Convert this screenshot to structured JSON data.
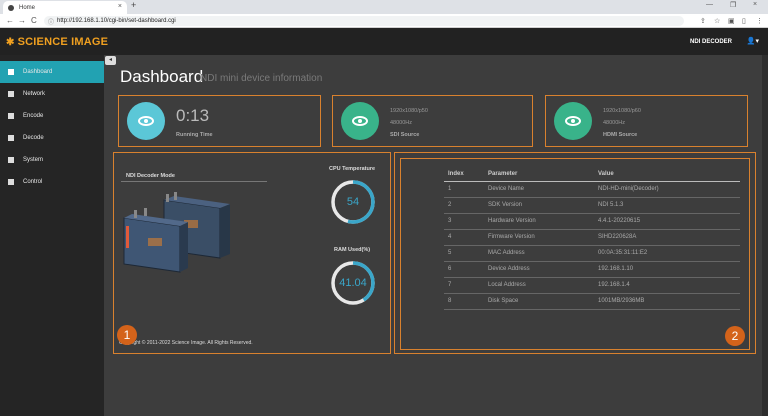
{
  "browser": {
    "tab_title": "Home",
    "tab_close": "×",
    "new_tab": "+",
    "url": "http://192.168.1.10/cgi-bin/set-dashboard.cgi",
    "win_min": "—",
    "win_max": "❐",
    "win_close": "×",
    "back": "←",
    "forward": "→",
    "reload": "C"
  },
  "header": {
    "brand": "SCIENCE IMAGE",
    "device_label": "NDI DECODER",
    "user_icon": "user-icon"
  },
  "sidebar": {
    "items": [
      {
        "label": "Dashboard",
        "icon": "home-icon",
        "active": true
      },
      {
        "label": "Network",
        "icon": "network-icon",
        "active": false
      },
      {
        "label": "Encode",
        "icon": "encode-icon",
        "active": false
      },
      {
        "label": "Decode",
        "icon": "monitor-icon",
        "active": false
      },
      {
        "label": "System",
        "icon": "system-icon",
        "active": false
      },
      {
        "label": "Control",
        "icon": "control-icon",
        "active": false
      }
    ]
  },
  "page": {
    "title": "Dashboard",
    "subtitle": "NDI mini device information"
  },
  "cards": {
    "running": {
      "value": "0:13",
      "label": "Running Time",
      "color": "#5bc7d7"
    },
    "sdi": {
      "line1": "1920x1080/p50",
      "line2": "48000Hz",
      "label": "SDI Source",
      "color": "#39b38a"
    },
    "hdmi": {
      "line1": "1920x1080/p60",
      "line2": "48000Hz",
      "label": "HDMI Source",
      "color": "#39b38a"
    }
  },
  "left_panel": {
    "mode_title": "NDI Decoder Mode",
    "cpu_label": "CPU Temperature",
    "cpu_value": "54",
    "cpu_fraction": 0.54,
    "ram_label": "RAM Used(%)",
    "ram_value": "41.04",
    "ram_fraction": 0.41,
    "copyright": "Copyright © 2011-2022 Science Image. All Rights Reserved.",
    "badge": "1"
  },
  "right_panel": {
    "badge": "2",
    "headers": [
      "Index",
      "Parameter",
      "Value"
    ],
    "rows": [
      [
        "1",
        "Device Name",
        "NDI-HD-mini(Decoder)"
      ],
      [
        "2",
        "SDK Version",
        "NDI 5.1.3"
      ],
      [
        "3",
        "Hardware Version",
        "4.4.1-20220615"
      ],
      [
        "4",
        "Firmware Version",
        "SIHD220628A"
      ],
      [
        "5",
        "MAC Address",
        "00:0A:35:31:11:E2"
      ],
      [
        "6",
        "Device Address",
        "192.168.1.10"
      ],
      [
        "7",
        "Local Address",
        "192.168.1.4"
      ],
      [
        "8",
        "Disk Space",
        "1001MB/2936MB"
      ]
    ]
  },
  "colors": {
    "accent": "#22a2b2",
    "panel_border": "#d9812e",
    "gauge": "#3aa6c9"
  }
}
